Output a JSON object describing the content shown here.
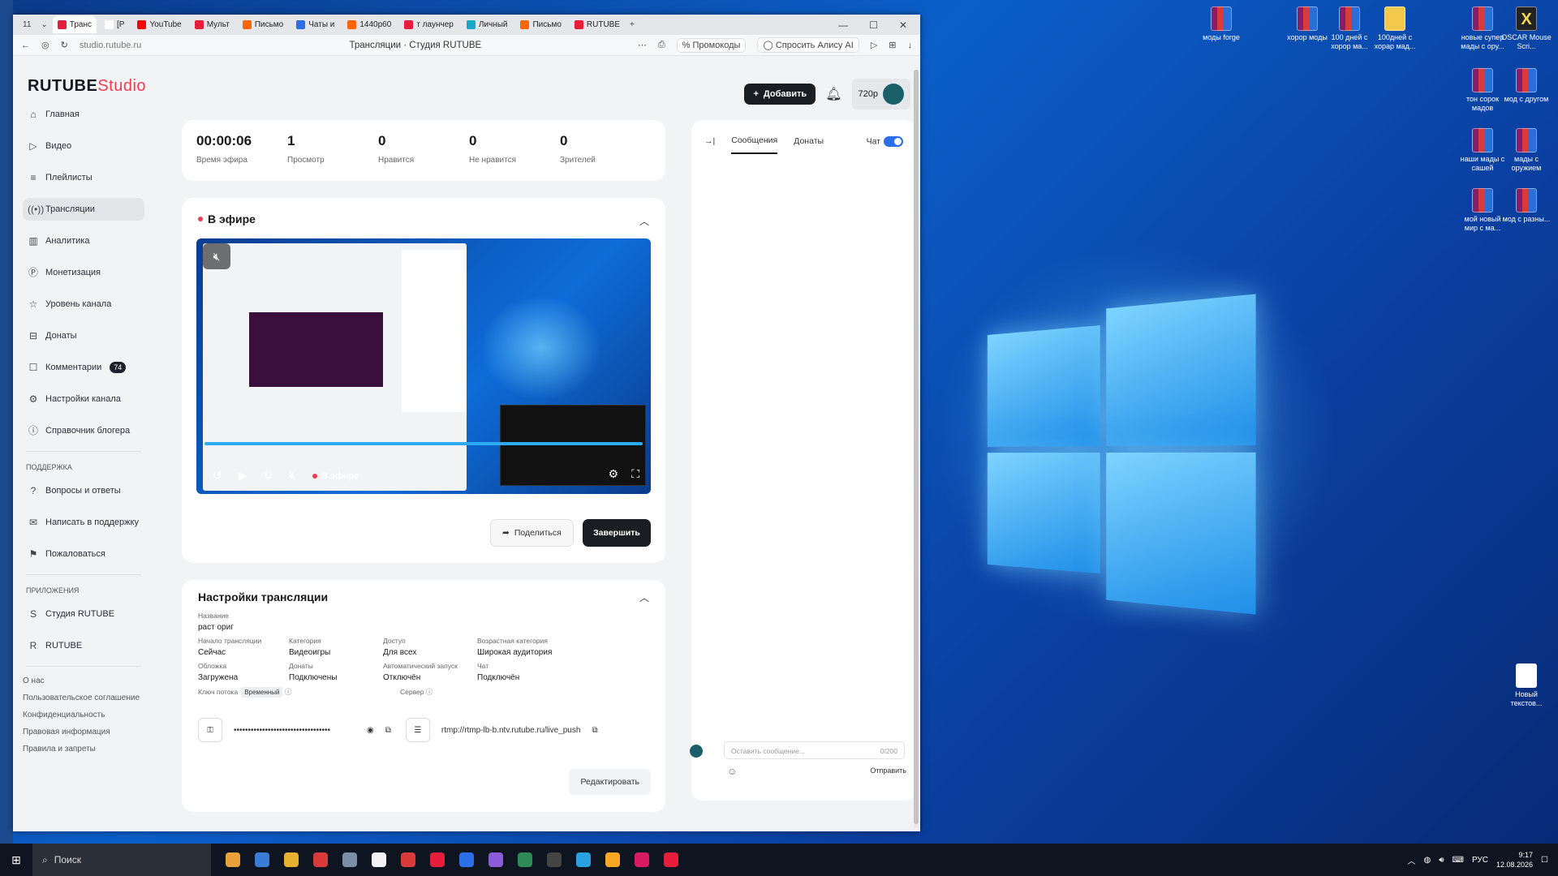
{
  "browser": {
    "tab_count": "11",
    "tabs": [
      {
        "label": "Транс",
        "color": "#e61e3c"
      },
      {
        "label": "[P",
        "color": "#ffffff"
      },
      {
        "label": "YouTube",
        "color": "#ff0000"
      },
      {
        "label": "Мульт",
        "color": "#e61e3c"
      },
      {
        "label": "Письмо",
        "color": "#ff6600"
      },
      {
        "label": "Чаты и",
        "color": "#2a6fe6"
      },
      {
        "label": "1440p60",
        "color": "#ff6600"
      },
      {
        "label": "т лаунчер",
        "color": "#e61e3c"
      },
      {
        "label": "Личный",
        "color": "#19a7c8"
      },
      {
        "label": "Письмо",
        "color": "#ff6600"
      },
      {
        "label": "RUTUBE",
        "color": "#e61e3c"
      }
    ],
    "url": "studio.rutube.ru",
    "page_title": "Трансляции · Студия RUTUBE",
    "promo": "Промокоды",
    "alice": "Спросить Алису AI"
  },
  "logo": {
    "brand": "RUTUBE",
    "studio": "Studio"
  },
  "nav": [
    {
      "label": "Главная",
      "icon": "⌂"
    },
    {
      "label": "Видео",
      "icon": "▷"
    },
    {
      "label": "Плейлисты",
      "icon": "≡"
    },
    {
      "label": "Трансляции",
      "icon": "((•))"
    },
    {
      "label": "Аналитика",
      "icon": "▥"
    },
    {
      "label": "Монетизация",
      "icon": "Ⓟ"
    },
    {
      "label": "Уровень канала",
      "icon": "☆"
    },
    {
      "label": "Донаты",
      "icon": "⊟"
    },
    {
      "label": "Комментарии",
      "icon": "☐",
      "badge": "74"
    },
    {
      "label": "Настройки канала",
      "icon": "⚙"
    },
    {
      "label": "Справочник блогера",
      "icon": "ⓘ"
    }
  ],
  "support": {
    "title": "ПОДДЕРЖКА",
    "items": [
      {
        "label": "Вопросы и ответы",
        "icon": "?"
      },
      {
        "label": "Написать в поддержку",
        "icon": "✉"
      },
      {
        "label": "Пожаловаться",
        "icon": "⚑"
      }
    ]
  },
  "apps": {
    "title": "ПРИЛОЖЕНИЯ",
    "items": [
      {
        "label": "Студия RUTUBE",
        "icon": "S"
      },
      {
        "label": "RUTUBE",
        "icon": "R"
      }
    ]
  },
  "footer": [
    "О нас",
    "Пользовательское соглашение",
    "Конфиденциальность",
    "Правовая информация",
    "Правила и запреты"
  ],
  "header": {
    "add_label": "Добавить",
    "quality": "720p"
  },
  "stats": [
    {
      "value": "00:00:06",
      "label": "Время эфира"
    },
    {
      "value": "1",
      "label": "Просмотр"
    },
    {
      "value": "0",
      "label": "Нравится"
    },
    {
      "value": "0",
      "label": "Не нравится"
    },
    {
      "value": "0",
      "label": "Зрителей"
    }
  ],
  "live": {
    "title": "В эфире",
    "player_live": "В эфире",
    "share_label": "Поделиться",
    "end_label": "Завершить"
  },
  "settings": {
    "title": "Настройки трансляции",
    "name_label": "Название",
    "name_value": "раст ориг",
    "fields": [
      {
        "label": "Начало трансляции",
        "value": "Сейчас"
      },
      {
        "label": "Категория",
        "value": "Видеоигры"
      },
      {
        "label": "Доступ",
        "value": "Для всех"
      },
      {
        "label": "Возрастная категория",
        "value": "Широкая аудитория"
      },
      {
        "label": "Обложка",
        "value": "Загружена"
      },
      {
        "label": "Донаты",
        "value": "Подключены"
      },
      {
        "label": "Автоматический запуск",
        "value": "Отключён"
      },
      {
        "label": "Чат",
        "value": "Подключён"
      }
    ],
    "key_label": "Ключ потока",
    "key_tag": "Временный",
    "key_value": "••••••••••••••••••••••••••••••••••",
    "server_label": "Сервер",
    "server_value": "rtmp://rtmp-lb-b.ntv.rutube.ru/live_push",
    "edit_label": "Редактировать"
  },
  "chat": {
    "tab_messages": "Сообщения",
    "tab_donates": "Донаты",
    "chat_label": "Чат",
    "placeholder": "Оставить сообщение...",
    "counter": "0/200",
    "send": "Отправить"
  },
  "desktop": [
    {
      "label": "моды forge",
      "kind": "rar"
    },
    {
      "label": "хорор моды",
      "kind": "rar"
    },
    {
      "label": "100 дней с хорор ма...",
      "kind": "rar"
    },
    {
      "label": "100дней с хорар мад...",
      "kind": "folder"
    },
    {
      "label": "новые супер мады с ору...",
      "kind": "rar"
    },
    {
      "label": "OSCAR Mouse Scri...",
      "kind": "x"
    },
    {
      "label": "тон сорок мадов",
      "kind": "rar"
    },
    {
      "label": "мод с другом",
      "kind": "rar"
    },
    {
      "label": "наши мады с сашей",
      "kind": "rar"
    },
    {
      "label": "мады с оружием",
      "kind": "rar"
    },
    {
      "label": "мой новый мир с ма...",
      "kind": "rar"
    },
    {
      "label": "мод с разны...",
      "kind": "rar"
    },
    {
      "label": "Новый текстов...",
      "kind": "doc"
    }
  ],
  "taskbar": {
    "search": "Поиск",
    "lang": "РУС",
    "time": "9:17",
    "date": "12.08.2026"
  }
}
